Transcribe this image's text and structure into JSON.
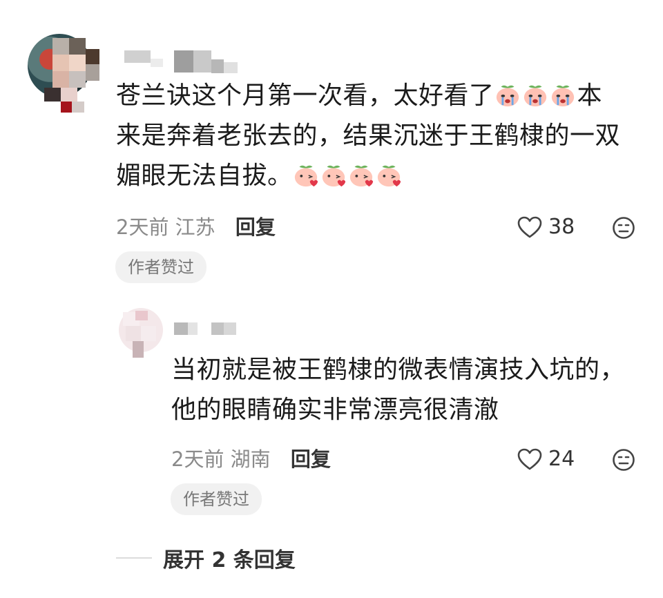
{
  "comments": [
    {
      "text_line1": "苍兰诀这个月第一次看，太好看了",
      "text_line1b": "本",
      "text_line2": "来是奔着老张去的，结果沉迷于王鹤棣的一双",
      "text_line3": "媚眼无法自拔。",
      "time": "2天前",
      "location": "江苏",
      "reply_label": "回复",
      "likes": "38",
      "badge": "作者赞过",
      "emojis_line1": [
        "crying-peach-emoji",
        "crying-peach-emoji",
        "crying-peach-emoji"
      ],
      "emojis_line3": [
        "heart-peach-emoji",
        "heart-peach-emoji",
        "heart-peach-emoji",
        "heart-peach-emoji"
      ]
    },
    {
      "text_line1": "当初就是被王鹤棣的微表情演技入坑的，",
      "text_line2": "他的眼睛确实非常漂亮很清澈",
      "time": "2天前",
      "location": "湖南",
      "reply_label": "回复",
      "likes": "24",
      "badge": "作者赞过"
    }
  ],
  "expand_label": "展开 2 条回复",
  "colors": {
    "text": "#1b1b1b",
    "meta": "#8a8a8a",
    "badge_bg": "#f1f1f1",
    "badge_text": "#777777"
  }
}
